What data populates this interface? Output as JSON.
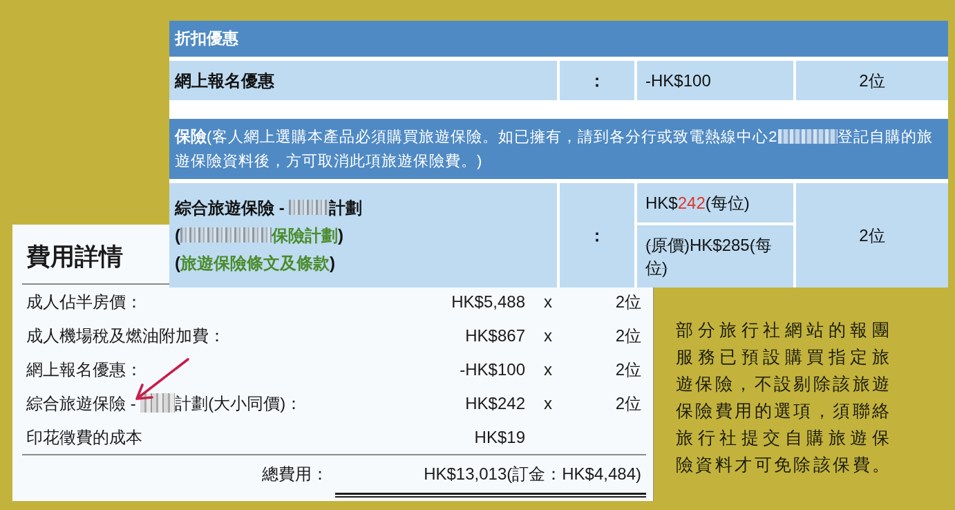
{
  "booking_table": {
    "sections": [
      {
        "header": {
          "title": "折扣優惠"
        },
        "rows": [
          {
            "item_lines": [
              [
                {
                  "kind": "text",
                  "text": "網上報名優惠"
                }
              ]
            ],
            "separator": "：",
            "prices": [
              {
                "parts": [
                  {
                    "text": "-HK$100",
                    "highlight": false
                  }
                ],
                "struck": false
              }
            ],
            "quantity": "2位"
          }
        ]
      },
      {
        "header": {
          "title": "保險",
          "note": [
            {
              "kind": "text",
              "text": "(客人網上選購本產品必須購買旅遊保險。如已擁有，請到各分行或致電熱線中心2"
            },
            {
              "kind": "redacted"
            },
            {
              "kind": "text",
              "text": "登記自購的旅遊保險資料後，方可取消此項旅遊保險費。)"
            }
          ]
        },
        "rows": [
          {
            "item_lines": [
              [
                {
                  "kind": "text",
                  "text": "綜合旅遊保險 - "
                },
                {
                  "kind": "redacted"
                },
                {
                  "kind": "text",
                  "text": "計劃"
                }
              ],
              [
                {
                  "kind": "text",
                  "text": "("
                },
                {
                  "kind": "redacted"
                },
                {
                  "kind": "link",
                  "text": "保險計劃"
                },
                {
                  "kind": "text",
                  "text": ")"
                }
              ],
              [
                {
                  "kind": "text",
                  "text": "("
                },
                {
                  "kind": "link",
                  "text": "旅遊保險條文及條款"
                },
                {
                  "kind": "text",
                  "text": ")"
                }
              ]
            ],
            "separator": "：",
            "prices": [
              {
                "parts": [
                  {
                    "text": "HK$",
                    "highlight": false
                  },
                  {
                    "text": "242",
                    "highlight": true
                  },
                  {
                    "text": "(每位)",
                    "highlight": false
                  }
                ],
                "struck": false
              },
              {
                "parts": [
                  {
                    "text": "(原價)HK$285(每位)",
                    "highlight": false
                  }
                ],
                "struck": true
              }
            ],
            "quantity": "2位"
          }
        ]
      }
    ]
  },
  "cost_details": {
    "title": "費用詳情",
    "rows": [
      {
        "label": [
          {
            "kind": "text",
            "text": "成人佔半房價："
          }
        ],
        "amount": "HK$5,488",
        "multiplier": "x",
        "quantity": "2位"
      },
      {
        "label": [
          {
            "kind": "text",
            "text": "成人機場稅及燃油附加費："
          }
        ],
        "amount": "HK$867",
        "multiplier": "x",
        "quantity": "2位"
      },
      {
        "label": [
          {
            "kind": "text",
            "text": "網上報名優惠："
          }
        ],
        "amount": "-HK$100",
        "multiplier": "x",
        "quantity": "2位"
      },
      {
        "label": [
          {
            "kind": "text",
            "text": "綜合旅遊保險 - "
          },
          {
            "kind": "redacted"
          },
          {
            "kind": "text",
            "text": "計劃(大小同價)："
          }
        ],
        "amount": "HK$242",
        "multiplier": "x",
        "quantity": "2位"
      },
      {
        "label": [
          {
            "kind": "text",
            "text": "印花徵費的成本"
          }
        ],
        "amount": "HK$19"
      }
    ],
    "total": {
      "label": "總費用：",
      "value": "HK$13,013(訂金：HK$4,484)"
    }
  },
  "caption": {
    "lines": [
      "部分旅行社網站的報團",
      "服務已預設購買指定旅",
      "遊保險，不設剔除該旅遊",
      "保險費用的選項，須聯絡",
      "旅行社提交自購旅遊保",
      "險資料才可免除該保費。"
    ]
  }
}
